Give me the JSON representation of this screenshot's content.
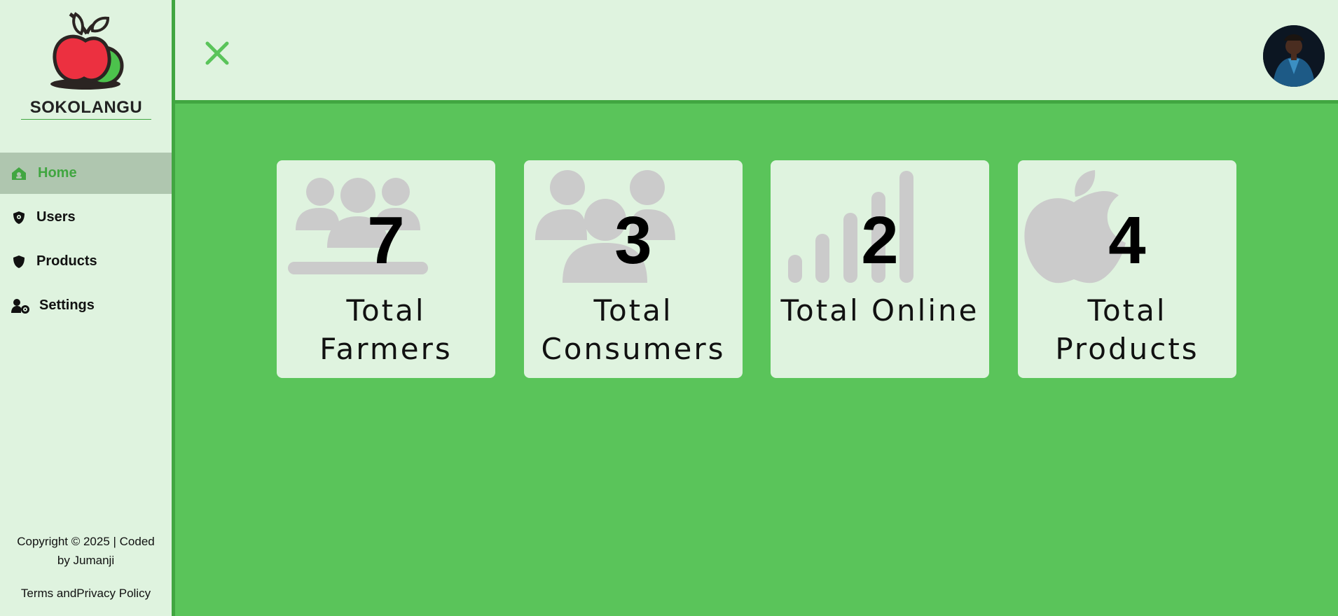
{
  "brand": {
    "name": "SOKOLANGU"
  },
  "nav": [
    {
      "label": "Home",
      "icon": "home-icon",
      "active": true
    },
    {
      "label": "Users",
      "icon": "shield-icon",
      "active": false
    },
    {
      "label": "Products",
      "icon": "shield-icon",
      "active": false
    },
    {
      "label": "Settings",
      "icon": "user-gear-icon",
      "active": false
    }
  ],
  "footer": {
    "copyright": "Copyright © 2025 | Coded by Jumanji",
    "terms": "Terms andPrivacy Policy"
  },
  "header": {
    "close_icon": "close-icon",
    "avatar": "user-avatar"
  },
  "cards": [
    {
      "value": "7",
      "label": "Total Farmers",
      "icon": "users-icon"
    },
    {
      "value": "3",
      "label": "Total Consumers",
      "icon": "users-group-icon"
    },
    {
      "value": "2",
      "label": "Total Online",
      "icon": "signal-icon"
    },
    {
      "value": "4",
      "label": "Total Products",
      "icon": "apple-icon"
    }
  ],
  "colors": {
    "accent": "#41a641",
    "background": "#5ac45a",
    "panel": "#dff3df",
    "icon_gray": "#cbcbcb"
  }
}
